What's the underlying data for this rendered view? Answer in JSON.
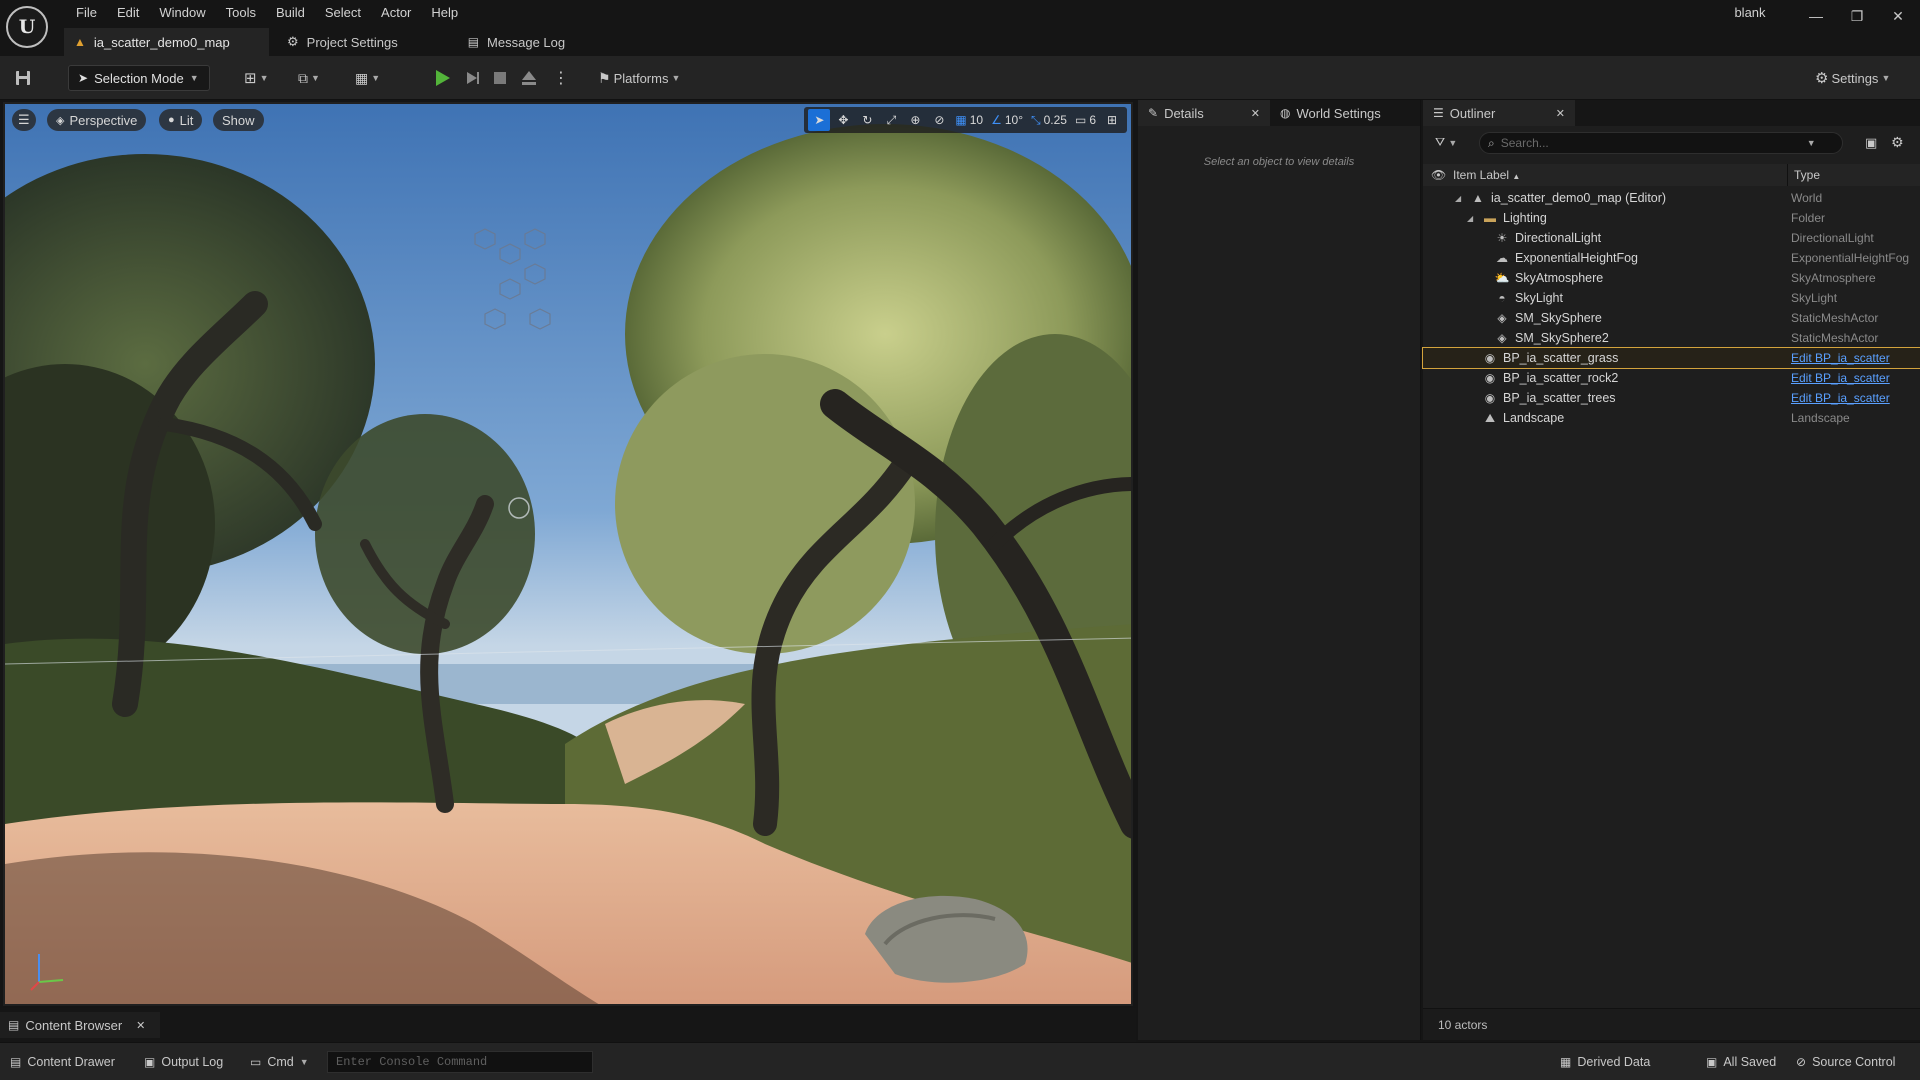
{
  "window": {
    "title": "blank",
    "minimize": "—",
    "restore": "❐",
    "close": "✕"
  },
  "menu": [
    "File",
    "Edit",
    "Window",
    "Tools",
    "Build",
    "Select",
    "Actor",
    "Help"
  ],
  "tabs": [
    {
      "label": "ia_scatter_demo0_map",
      "active": true
    },
    {
      "label": "Project Settings",
      "active": false
    },
    {
      "label": "Message Log",
      "active": false
    }
  ],
  "toolbar": {
    "selection_mode": "Selection Mode",
    "platforms": "Platforms",
    "settings": "Settings"
  },
  "viewport": {
    "perspective": "Perspective",
    "lit": "Lit",
    "show": "Show",
    "grid_snap": "10",
    "rotation_snap": "10°",
    "scale_snap": "0.25",
    "camera_speed": "6"
  },
  "details": {
    "tab_details": "Details",
    "tab_world_settings": "World Settings",
    "empty_message": "Select an object to view details"
  },
  "outliner": {
    "title": "Outliner",
    "search_placeholder": "Search...",
    "col_label": "Item Label",
    "col_type": "Type",
    "rows": [
      {
        "label": "ia_scatter_demo0_map (Editor)",
        "type": "World"
      },
      {
        "label": "Lighting",
        "type": "Folder"
      },
      {
        "label": "DirectionalLight",
        "type": "DirectionalLight"
      },
      {
        "label": "ExponentialHeightFog",
        "type": "ExponentialHeightFog"
      },
      {
        "label": "SkyAtmosphere",
        "type": "SkyAtmosphere"
      },
      {
        "label": "SkyLight",
        "type": "SkyLight"
      },
      {
        "label": "SM_SkySphere",
        "type": "StaticMeshActor"
      },
      {
        "label": "SM_SkySphere2",
        "type": "StaticMeshActor"
      },
      {
        "label": "BP_ia_scatter_grass",
        "type": "Edit BP_ia_scatter"
      },
      {
        "label": "BP_ia_scatter_rock2",
        "type": "Edit BP_ia_scatter"
      },
      {
        "label": "BP_ia_scatter_trees",
        "type": "Edit BP_ia_scatter"
      },
      {
        "label": "Landscape",
        "type": "Landscape"
      }
    ],
    "actor_count": "10 actors"
  },
  "bottom": {
    "content_browser": "Content Browser",
    "content_drawer": "Content Drawer",
    "output_log": "Output Log",
    "cmd": "Cmd",
    "console_placeholder": "Enter Console Command",
    "derived_data": "Derived Data",
    "all_saved": "All Saved",
    "source_control": "Source Control"
  },
  "colors": {
    "accent": "#1b6fd6",
    "link": "#5aa0ff",
    "highlight": "#d3a33c",
    "play": "#53b43a"
  }
}
